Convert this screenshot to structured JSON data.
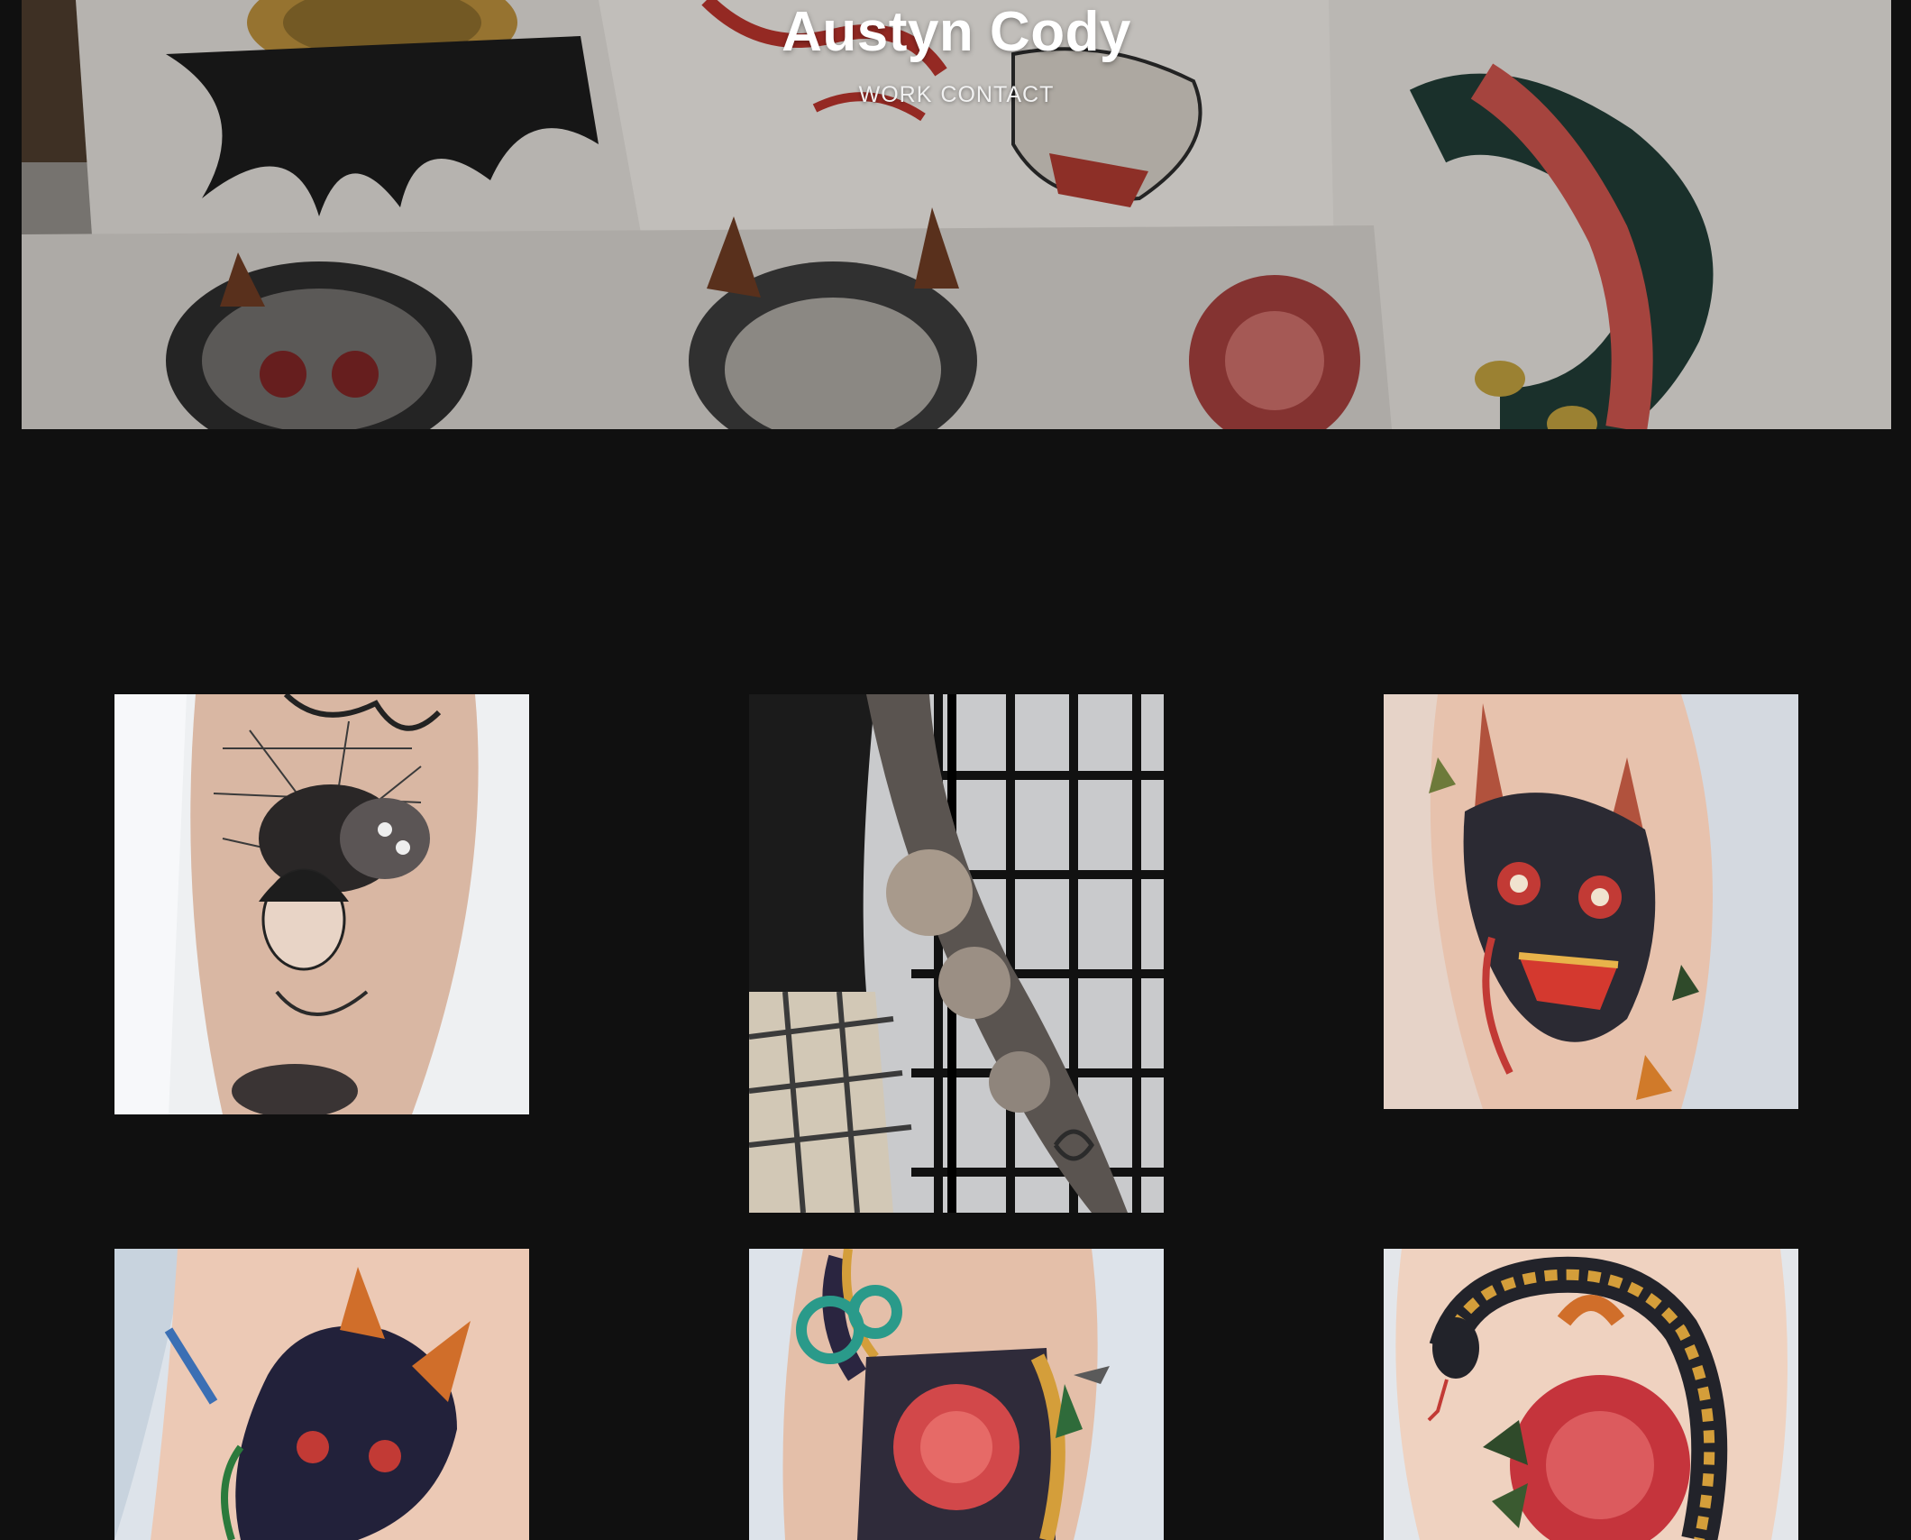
{
  "site": {
    "title": "Austyn Cody"
  },
  "nav": {
    "items": [
      {
        "label": "WORK"
      },
      {
        "label": "CONTACT"
      }
    ]
  },
  "hero": {
    "icon": "flash-sheet-banner-image"
  },
  "gallery": {
    "items": [
      {
        "icon": "spider-geisha-tattoo-image"
      },
      {
        "icon": "chrysanthemum-sleeve-tattoo-image"
      },
      {
        "icon": "hannya-mask-tattoo-image"
      },
      {
        "icon": "oni-mask-tattoo-image"
      },
      {
        "icon": "peony-snake-tattoo-image"
      },
      {
        "icon": "snake-chrysanthemum-tattoo-image"
      }
    ]
  },
  "colors": {
    "background": "#101010",
    "text": "#ffffff"
  }
}
